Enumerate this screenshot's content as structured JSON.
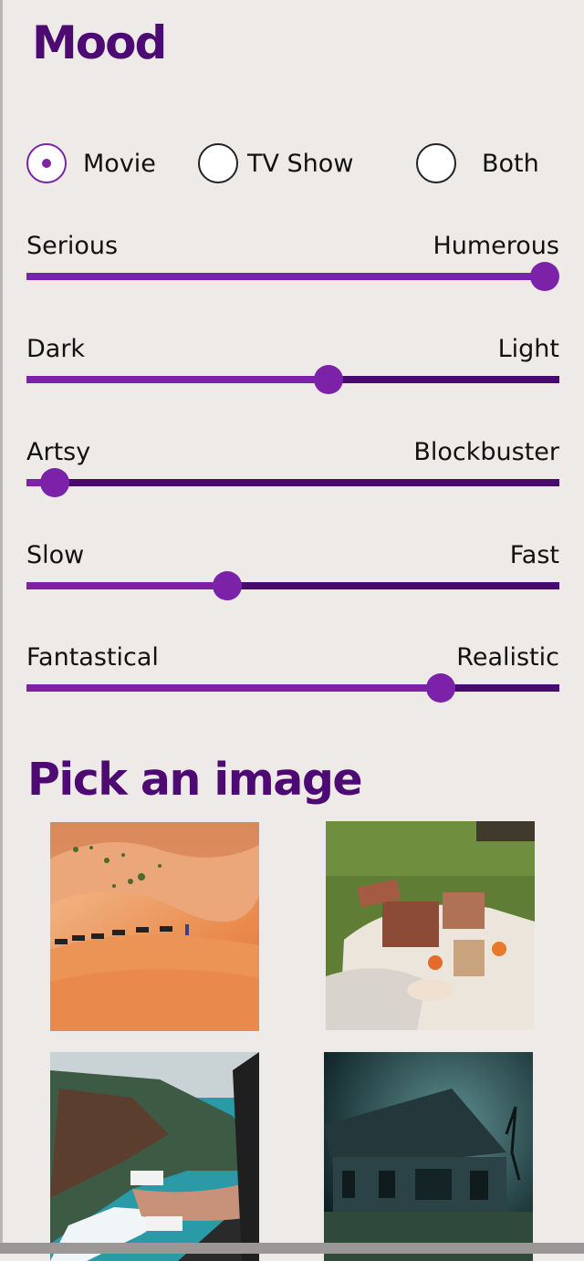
{
  "mood": {
    "title": "Mood",
    "type_options": [
      {
        "label": "Movie",
        "selected": true
      },
      {
        "label": "TV Show",
        "selected": false
      },
      {
        "label": "Both",
        "selected": false
      }
    ],
    "sliders": [
      {
        "left": "Serious",
        "right": "Humerous",
        "value": 1.0
      },
      {
        "left": "Dark",
        "right": "Light",
        "value": 0.57
      },
      {
        "left": "Artsy",
        "right": "Blockbuster",
        "value": 0.05
      },
      {
        "left": "Slow",
        "right": "Fast",
        "value": 0.38
      },
      {
        "left": "Fantastical",
        "right": "Realistic",
        "value": 0.79
      }
    ]
  },
  "pick_image": {
    "title": "Pick an image",
    "images": [
      {
        "name": "desert-camel-caravan-image"
      },
      {
        "name": "picnic-basket-image"
      },
      {
        "name": "cliff-helicopter-view-image"
      },
      {
        "name": "abandoned-house-storm-image"
      }
    ]
  },
  "colors": {
    "background": "#eeeae8",
    "heading": "#4e0a73",
    "accent": "#7b22a8",
    "track_dark": "#480a6e"
  }
}
